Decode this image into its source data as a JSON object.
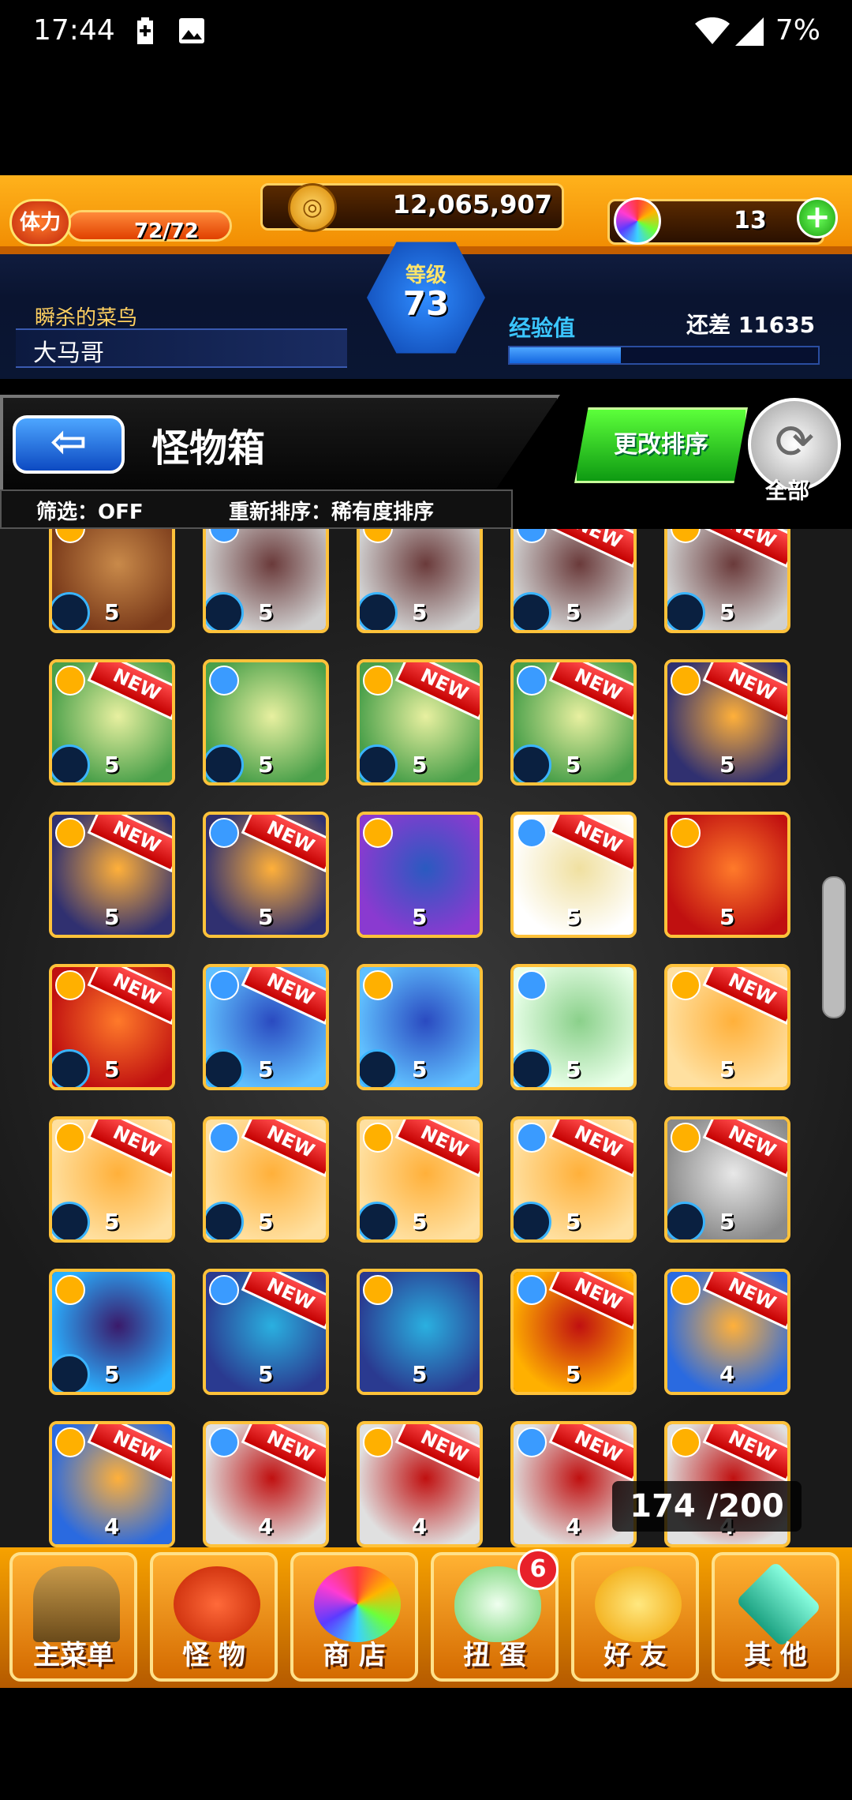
{
  "status_bar": {
    "time": "17:44",
    "battery": "7%"
  },
  "player": {
    "stamina_label": "体力",
    "stamina": "72/72",
    "stamina_fraction": 1.0,
    "gold": "12,065,907",
    "gems": "13",
    "level_label": "等级",
    "level": "73",
    "title": "瞬杀的菜鸟",
    "name": "大马哥",
    "exp_label": "经验值",
    "exp_remaining": "还差 11635",
    "exp_fraction": 0.36
  },
  "page": {
    "title": "怪物箱",
    "filter": "筛选：OFF",
    "sort": "重新排序：稀有度排序",
    "sort_button": "更改排序",
    "all_label": "全部",
    "box_count": "174 /200"
  },
  "monsters": [
    {
      "rarity": "5",
      "new": false
    },
    {
      "rarity": "5",
      "new": false
    },
    {
      "rarity": "5",
      "new": false
    },
    {
      "rarity": "5",
      "new": true
    },
    {
      "rarity": "5",
      "new": true
    },
    {
      "rarity": "5",
      "new": true
    },
    {
      "rarity": "5",
      "new": false
    },
    {
      "rarity": "5",
      "new": true
    },
    {
      "rarity": "5",
      "new": true
    },
    {
      "rarity": "5",
      "new": true
    },
    {
      "rarity": "5",
      "new": true
    },
    {
      "rarity": "5",
      "new": true
    },
    {
      "rarity": "5",
      "new": false
    },
    {
      "rarity": "5",
      "new": true
    },
    {
      "rarity": "5",
      "new": false
    },
    {
      "rarity": "5",
      "new": true
    },
    {
      "rarity": "5",
      "new": true
    },
    {
      "rarity": "5",
      "new": false
    },
    {
      "rarity": "5",
      "new": false
    },
    {
      "rarity": "5",
      "new": true
    },
    {
      "rarity": "5",
      "new": true
    },
    {
      "rarity": "5",
      "new": true
    },
    {
      "rarity": "5",
      "new": true
    },
    {
      "rarity": "5",
      "new": true
    },
    {
      "rarity": "5",
      "new": true
    },
    {
      "rarity": "5",
      "new": false
    },
    {
      "rarity": "5",
      "new": true
    },
    {
      "rarity": "5",
      "new": false
    },
    {
      "rarity": "5",
      "new": true
    },
    {
      "rarity": "4",
      "new": true
    },
    {
      "rarity": "4",
      "new": true
    },
    {
      "rarity": "4",
      "new": true
    },
    {
      "rarity": "4",
      "new": true
    },
    {
      "rarity": "4",
      "new": true
    },
    {
      "rarity": "4",
      "new": true
    }
  ],
  "new_label": "NEW",
  "nav": [
    {
      "label": "主菜单"
    },
    {
      "label": "怪 物"
    },
    {
      "label": "商 店"
    },
    {
      "label": "扭 蛋",
      "badge": "6"
    },
    {
      "label": "好 友"
    },
    {
      "label": "其 他"
    }
  ],
  "colors": {
    "accent_orange": "#f08a00",
    "accent_blue": "#1466e0",
    "new_red": "#e8202a",
    "sort_green": "#0e9a12"
  }
}
